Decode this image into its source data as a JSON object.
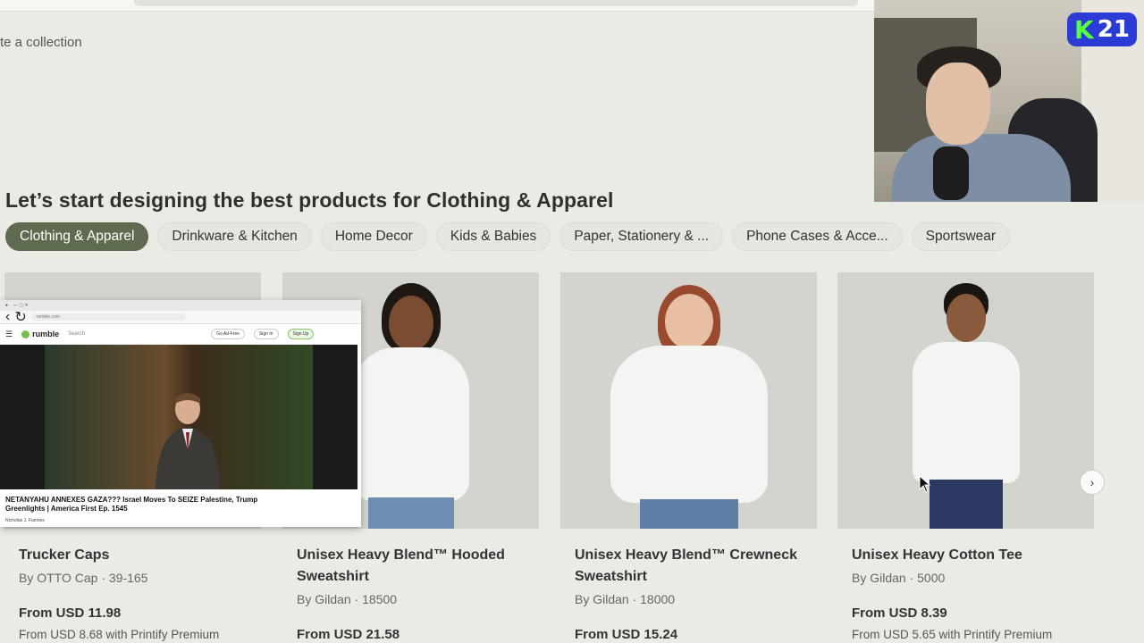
{
  "page": {
    "collection_link": "te a collection",
    "headline": "Let’s start designing the best products for Clothing & Apparel"
  },
  "tabs": [
    {
      "label": "Clothing & Apparel",
      "active": true
    },
    {
      "label": "Drinkware & Kitchen",
      "active": false
    },
    {
      "label": "Home Decor",
      "active": false
    },
    {
      "label": "Kids & Babies",
      "active": false
    },
    {
      "label": "Paper, Stationery & ...",
      "active": false
    },
    {
      "label": "Phone Cases & Acce...",
      "active": false
    },
    {
      "label": "Sportswear",
      "active": false
    }
  ],
  "products": [
    {
      "title": "Trucker Caps",
      "by": "By OTTO Cap · 39-165",
      "price": "From USD 11.98",
      "premium": "From USD 8.68 with Printify Premium"
    },
    {
      "title": "Unisex Heavy Blend™ Hooded Sweatshirt",
      "by": "By Gildan · 18500",
      "price": "From USD 21.58",
      "premium": ""
    },
    {
      "title": "Unisex Heavy Blend™ Crewneck Sweatshirt",
      "by": "By Gildan · 18000",
      "price": "From USD 15.24",
      "premium": ""
    },
    {
      "title": "Unisex Heavy Cotton Tee",
      "by": "By Gildan · 5000",
      "price": "From USD 8.39",
      "premium": "From USD 5.65 with Printify Premium"
    }
  ],
  "carousel": {
    "next_icon": "chevron-right-icon",
    "next_glyph": "›"
  },
  "overlay_badge": {
    "letter": "K",
    "number": "21"
  },
  "pip_browser": {
    "logo": "rumble",
    "search_placeholder": "Search",
    "go_ad_free": "Go Ad-Free",
    "sign_in": "Sign In",
    "sign_up": "Sign Up",
    "video_title": "NETANYAHU ANNEXES GAZA??? Israel Moves To SEIZE Palestine, Trump Greenlights | America First Ep. 1545",
    "channel": "Nicholas J. Fuentes"
  },
  "colors": {
    "page_bg": "#ebebe6",
    "active_tab": "#5e6b4f",
    "badge_bg": "#2b3bd6",
    "badge_letter": "#55ff3a"
  }
}
